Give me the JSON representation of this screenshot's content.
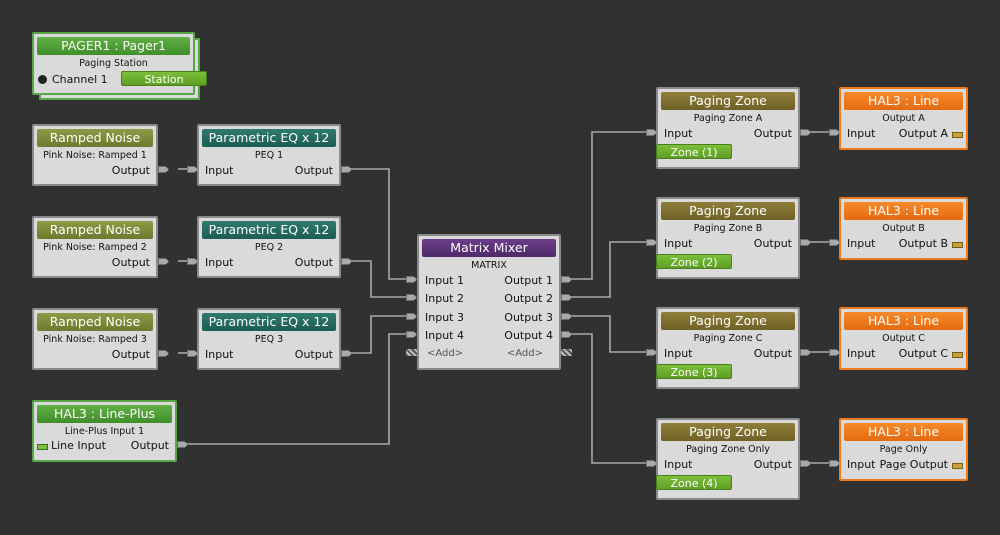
{
  "pager": {
    "header": "PAGER1 : Pager1",
    "sub": "Paging Station",
    "channel": "Channel 1",
    "station": "Station"
  },
  "noise": [
    {
      "header": "Ramped Noise",
      "sub": "Pink Noise: Ramped 1",
      "out": "Output"
    },
    {
      "header": "Ramped Noise",
      "sub": "Pink Noise: Ramped 2",
      "out": "Output"
    },
    {
      "header": "Ramped Noise",
      "sub": "Pink Noise: Ramped 3",
      "out": "Output"
    }
  ],
  "peq": [
    {
      "header": "Parametric EQ x 12",
      "sub": "PEQ 1",
      "in": "Input",
      "out": "Output"
    },
    {
      "header": "Parametric EQ x 12",
      "sub": "PEQ 2",
      "in": "Input",
      "out": "Output"
    },
    {
      "header": "Parametric EQ x 12",
      "sub": "PEQ 3",
      "in": "Input",
      "out": "Output"
    }
  ],
  "lineplus": {
    "header": "HAL3 : Line-Plus",
    "sub": "Line-Plus Input 1",
    "in": "Line Input",
    "out": "Output"
  },
  "matrix": {
    "header": "Matrix Mixer",
    "sub": "MATRIX",
    "inputs": [
      "Input 1",
      "Input 2",
      "Input 3",
      "Input 4"
    ],
    "outputs": [
      "Output 1",
      "Output 2",
      "Output 3",
      "Output 4"
    ],
    "add_in": "<Add>",
    "add_out": "<Add>"
  },
  "zones": [
    {
      "header": "Paging Zone",
      "sub": "Paging Zone A",
      "in": "Input",
      "out": "Output",
      "chip": "Zone (1)"
    },
    {
      "header": "Paging Zone",
      "sub": "Paging Zone B",
      "in": "Input",
      "out": "Output",
      "chip": "Zone (2)"
    },
    {
      "header": "Paging Zone",
      "sub": "Paging Zone C",
      "in": "Input",
      "out": "Output",
      "chip": "Zone (3)"
    },
    {
      "header": "Paging Zone",
      "sub": "Paging Zone Only",
      "in": "Input",
      "out": "Output",
      "chip": "Zone (4)"
    }
  ],
  "hal": [
    {
      "header": "HAL3 : Line",
      "sub": "Output A",
      "in": "Input",
      "out": "Output A"
    },
    {
      "header": "HAL3 : Line",
      "sub": "Output B",
      "in": "Input",
      "out": "Output B"
    },
    {
      "header": "HAL3 : Line",
      "sub": "Output C",
      "in": "Input",
      "out": "Output C"
    },
    {
      "header": "HAL3 : Line",
      "sub": "Page Only",
      "in": "Input",
      "out": "Page Output"
    }
  ],
  "colors": {
    "background": "#313131",
    "wire": "#a9a9a9",
    "olive": "#7d8a3a",
    "teal": "#256b62",
    "purple": "#5e3479",
    "green": "#56a846",
    "orange": "#ee7a1e",
    "brown": "#7f6f30"
  },
  "icons": {
    "pager_channel": "bulb-icon",
    "line_input": "connector-icon",
    "line_output": "connector-icon",
    "add": "hatch-icon"
  }
}
